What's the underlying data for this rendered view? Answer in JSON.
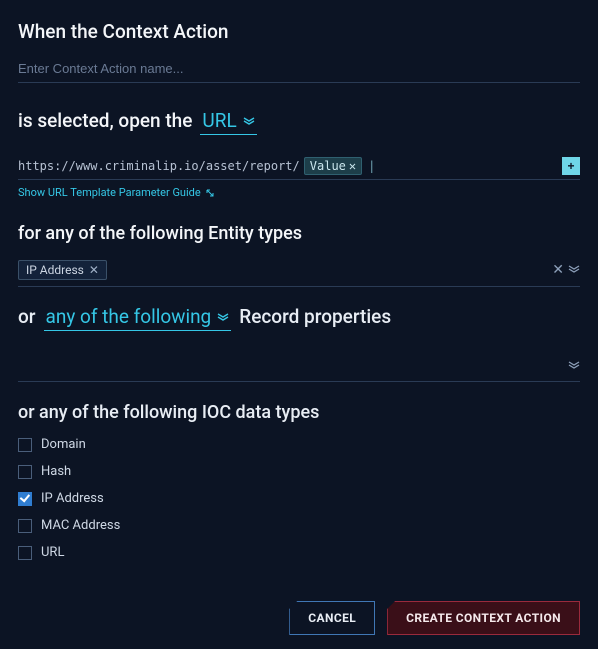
{
  "headings": {
    "when": "When the Context Action",
    "is_selected": "is selected, open the",
    "for_entities": "for any of the following Entity types",
    "or": "or",
    "record_props": "Record properties",
    "ioc_types": "or any of the following IOC data types"
  },
  "name_input": {
    "placeholder": "Enter Context Action name...",
    "value": ""
  },
  "open_type": {
    "selected": "URL"
  },
  "url_template": {
    "prefix": "https://www.criminalip.io/asset/report/",
    "token": "Value"
  },
  "guide_link": "Show URL Template Parameter Guide",
  "entity_chips": [
    {
      "label": "IP Address"
    }
  ],
  "record_condition": {
    "selected": "any of the following"
  },
  "ioc_options": [
    {
      "label": "Domain",
      "checked": false
    },
    {
      "label": "Hash",
      "checked": false
    },
    {
      "label": "IP Address",
      "checked": true
    },
    {
      "label": "MAC Address",
      "checked": false
    },
    {
      "label": "URL",
      "checked": false
    }
  ],
  "buttons": {
    "cancel": "CANCEL",
    "create": "CREATE CONTEXT ACTION"
  }
}
